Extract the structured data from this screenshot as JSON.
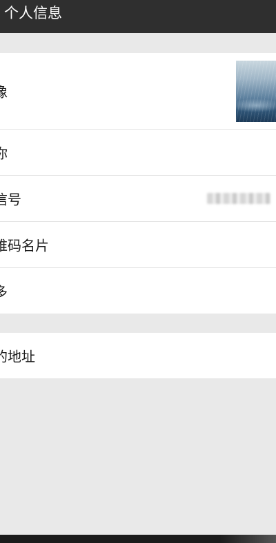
{
  "header": {
    "title": "个人信息"
  },
  "profile_group": {
    "rows": [
      {
        "label": "像",
        "value_type": "avatar-image"
      },
      {
        "label": "你",
        "value_type": "none"
      },
      {
        "label": "信号",
        "value_type": "blurred-text"
      },
      {
        "label": "维码名片",
        "value_type": "none"
      },
      {
        "label": "多",
        "value_type": "none"
      }
    ]
  },
  "address_group": {
    "rows": [
      {
        "label": "的地址"
      }
    ]
  },
  "colors": {
    "titlebar": "#2f2f2f",
    "background": "#e9e9e9",
    "row": "#ffffff",
    "divider": "#e3e3e3"
  }
}
